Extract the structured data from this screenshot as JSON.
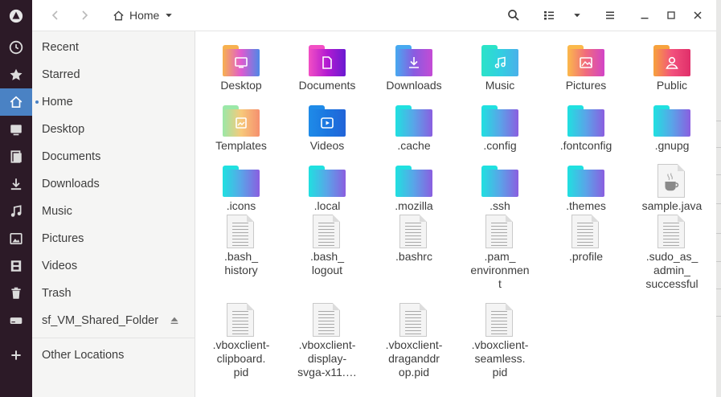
{
  "window": {
    "location_label": "Home",
    "nav": {
      "back_icon": "chevron-left-icon",
      "forward_icon": "chevron-right-icon"
    },
    "toolbar": {
      "search_icon": "search-icon",
      "view_icon": "view-options-icon",
      "dropdown_icon": "chevron-down-icon",
      "menu_icon": "hamburger-menu-icon",
      "minimize_icon": "minimize-icon",
      "maximize_icon": "maximize-icon",
      "close_icon": "close-icon"
    }
  },
  "colors": {
    "accent": "#4a82c4",
    "dock_bg": "#2c1a27",
    "sidebar_bg": "#f5f5f4"
  },
  "sidebar": {
    "items": [
      {
        "label": "Recent",
        "icon": "clock-icon"
      },
      {
        "label": "Starred",
        "icon": "star-icon"
      },
      {
        "label": "Home",
        "icon": "home-icon",
        "active": true
      },
      {
        "label": "Desktop",
        "icon": "desktop-icon"
      },
      {
        "label": "Documents",
        "icon": "documents-icon"
      },
      {
        "label": "Downloads",
        "icon": "download-icon"
      },
      {
        "label": "Music",
        "icon": "music-icon"
      },
      {
        "label": "Pictures",
        "icon": "pictures-icon"
      },
      {
        "label": "Videos",
        "icon": "videos-icon"
      },
      {
        "label": "Trash",
        "icon": "trash-icon"
      },
      {
        "label": "sf_VM_Shared_Folder",
        "icon": "drive-icon",
        "eject_icon": "eject-icon"
      }
    ],
    "other_locations": {
      "label": "Other Locations",
      "icon": "plus-icon"
    }
  },
  "files": [
    {
      "name": "Desktop",
      "kind": "folder",
      "glyph": "desktop-icon",
      "colors": [
        "#f7b14f",
        "#e05ad0",
        "#4f88e6"
      ]
    },
    {
      "name": "Documents",
      "kind": "folder",
      "glyph": "document-icon",
      "colors": [
        "#f24fc4",
        "#b31ad1",
        "#6a1ad1"
      ]
    },
    {
      "name": "Downloads",
      "kind": "folder",
      "glyph": "download-icon",
      "colors": [
        "#47a9f0",
        "#8a5be0",
        "#c44bd5"
      ]
    },
    {
      "name": "Music",
      "kind": "folder",
      "glyph": "music-icon",
      "colors": [
        "#2be3c8",
        "#31cfe0",
        "#4ab0ea"
      ]
    },
    {
      "name": "Pictures",
      "kind": "folder",
      "glyph": "picture-icon",
      "colors": [
        "#fbb94b",
        "#f06a7d",
        "#d244c7"
      ]
    },
    {
      "name": "Public",
      "kind": "folder",
      "glyph": "user-icon",
      "colors": [
        "#f7a23d",
        "#f2517d",
        "#e02f6a"
      ]
    },
    {
      "name": "Templates",
      "kind": "folder",
      "glyph": "template-icon",
      "colors": [
        "#9be8a8",
        "#f7c97a",
        "#f5906f"
      ]
    },
    {
      "name": "Videos",
      "kind": "folder",
      "glyph": "video-icon",
      "colors": [
        "#1f8be8",
        "#1b77e0",
        "#2264d8"
      ]
    },
    {
      "name": ".cache",
      "kind": "folder",
      "colors": [
        "#20e0e0",
        "#5aa4e8",
        "#8a5ee0"
      ]
    },
    {
      "name": ".config",
      "kind": "folder",
      "colors": [
        "#20e0e0",
        "#5aa4e8",
        "#8a5ee0"
      ]
    },
    {
      "name": ".fontconfig",
      "kind": "folder",
      "colors": [
        "#20e0e0",
        "#5aa4e8",
        "#8a5ee0"
      ]
    },
    {
      "name": ".gnupg",
      "kind": "folder",
      "colors": [
        "#20e0e0",
        "#5aa4e8",
        "#8a5ee0"
      ]
    },
    {
      "name": ".icons",
      "kind": "folder",
      "colors": [
        "#20e0e0",
        "#5aa4e8",
        "#8a5ee0"
      ]
    },
    {
      "name": ".local",
      "kind": "folder",
      "colors": [
        "#20e0e0",
        "#5aa4e8",
        "#8a5ee0"
      ]
    },
    {
      "name": ".mozilla",
      "kind": "folder",
      "colors": [
        "#20e0e0",
        "#5aa4e8",
        "#8a5ee0"
      ]
    },
    {
      "name": ".ssh",
      "kind": "folder",
      "colors": [
        "#20e0e0",
        "#5aa4e8",
        "#8a5ee0"
      ]
    },
    {
      "name": ".themes",
      "kind": "folder",
      "colors": [
        "#20e0e0",
        "#5aa4e8",
        "#8a5ee0"
      ]
    },
    {
      "name": "sample.java",
      "kind": "java"
    },
    {
      "name": ".bash_\nhistory",
      "kind": "text"
    },
    {
      "name": ".bash_\nlogout",
      "kind": "text"
    },
    {
      "name": ".bashrc",
      "kind": "text"
    },
    {
      "name": ".pam_\nenvironmen\nt",
      "kind": "text"
    },
    {
      "name": ".profile",
      "kind": "text"
    },
    {
      "name": ".sudo_as_\nadmin_\nsuccessful",
      "kind": "text"
    },
    {
      "name": ".vboxclient-\nclipboard.\npid",
      "kind": "text"
    },
    {
      "name": ".vboxclient-\ndisplay-\nsvga-x11.…",
      "kind": "text"
    },
    {
      "name": ".vboxclient-\ndraganddr\nop.pid",
      "kind": "text"
    },
    {
      "name": ".vboxclient-\nseamless.\npid",
      "kind": "text"
    }
  ]
}
